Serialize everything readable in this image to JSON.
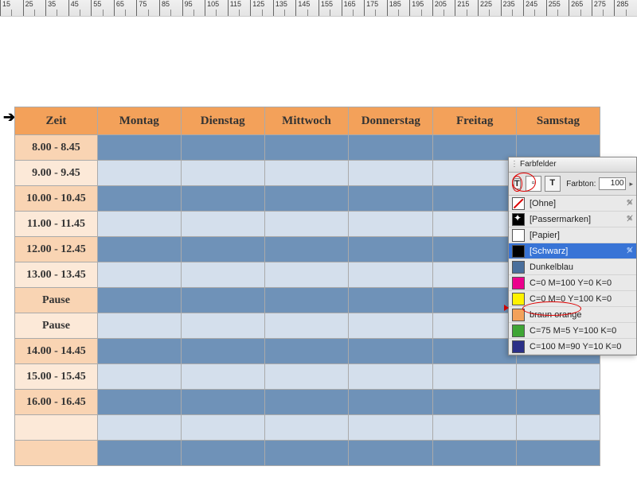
{
  "ruler": {
    "start": 15,
    "end": 295,
    "step": 10
  },
  "schedule": {
    "headers": [
      "Zeit",
      "Montag",
      "Dienstag",
      "Mittwoch",
      "Donnerstag",
      "Freitag",
      "Samstag"
    ],
    "times": [
      "8.00 - 8.45",
      "9.00 - 9.45",
      "10.00 - 10.45",
      "11.00 - 11.45",
      "12.00 - 12.45",
      "13.00 - 13.45",
      "Pause",
      "Pause",
      "14.00 - 14.45",
      "15.00 - 15.45",
      "16.00 - 16.45",
      "",
      ""
    ]
  },
  "panel": {
    "title": "Farbfelder",
    "tone_label": "Farbton:",
    "tone_value": "100",
    "swatches": [
      {
        "name": "[Ohne]",
        "color": "none",
        "locked": true
      },
      {
        "name": "[Passermarken]",
        "color": "reg",
        "locked": true
      },
      {
        "name": "[Papier]",
        "color": "#ffffff",
        "locked": false
      },
      {
        "name": "[Schwarz]",
        "color": "#000000",
        "locked": true,
        "selected": true
      },
      {
        "name": "Dunkelblau",
        "color": "#4a6f9c",
        "locked": false
      },
      {
        "name": "C=0 M=100 Y=0 K=0",
        "color": "#ec008c",
        "locked": false
      },
      {
        "name": "C=0 M=0 Y=100 K=0",
        "color": "#fff200",
        "locked": false
      },
      {
        "name": "braun orange",
        "color": "#f3a15a",
        "locked": false
      },
      {
        "name": "C=75 M=5 Y=100 K=0",
        "color": "#3fa535",
        "locked": false
      },
      {
        "name": "C=100 M=90 Y=10 K=0",
        "color": "#2a2f87",
        "locked": false
      }
    ]
  },
  "icons": {
    "fill_T": "T",
    "stroke_T": "T",
    "farbtone_arrow": "▸",
    "locked": "✎"
  }
}
